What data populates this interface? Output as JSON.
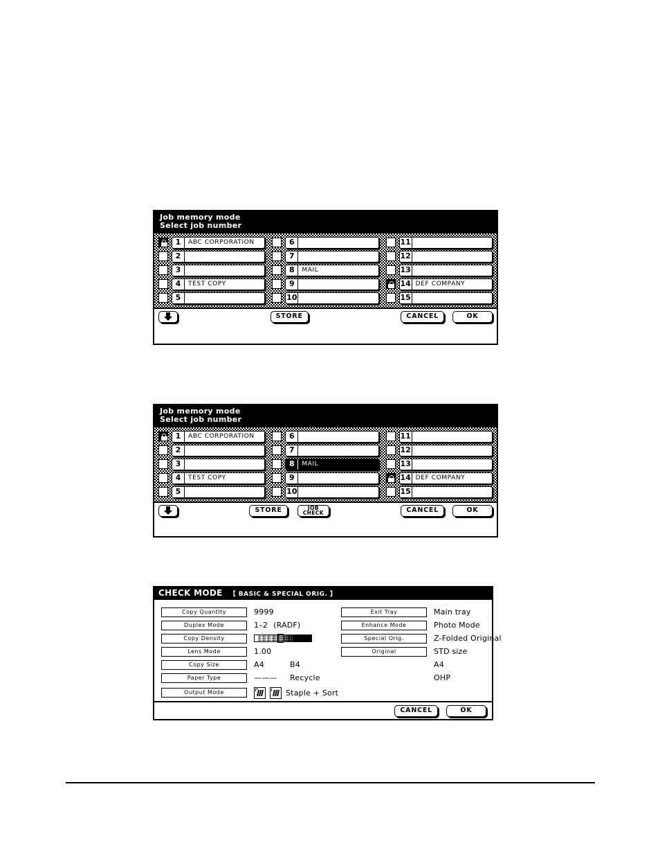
{
  "panels": {
    "job_memory_1": {
      "title_line1": "Job memory mode",
      "title_line2": "Select job number",
      "jobs": [
        {
          "num": "1",
          "name": "ABC CORPORATION",
          "locked": true,
          "selected": false
        },
        {
          "num": "2",
          "name": "",
          "locked": false,
          "selected": false
        },
        {
          "num": "3",
          "name": "",
          "locked": false,
          "selected": false
        },
        {
          "num": "4",
          "name": "TEST COPY",
          "locked": false,
          "selected": false
        },
        {
          "num": "5",
          "name": "",
          "locked": false,
          "selected": false
        },
        {
          "num": "6",
          "name": "",
          "locked": false,
          "selected": false
        },
        {
          "num": "7",
          "name": "",
          "locked": false,
          "selected": false
        },
        {
          "num": "8",
          "name": "MAIL",
          "locked": false,
          "selected": false
        },
        {
          "num": "9",
          "name": "",
          "locked": false,
          "selected": false
        },
        {
          "num": "10",
          "name": "",
          "locked": false,
          "selected": false
        },
        {
          "num": "11",
          "name": "",
          "locked": false,
          "selected": false
        },
        {
          "num": "12",
          "name": "",
          "locked": false,
          "selected": false
        },
        {
          "num": "13",
          "name": "",
          "locked": false,
          "selected": false
        },
        {
          "num": "14",
          "name": "DEF COMPANY",
          "locked": true,
          "selected": false
        },
        {
          "num": "15",
          "name": "",
          "locked": false,
          "selected": false
        }
      ],
      "buttons": {
        "scroll_down": "down-arrow",
        "store": "STORE",
        "cancel": "CANCEL",
        "ok": "OK"
      }
    },
    "job_memory_2": {
      "title_line1": "Job memory mode",
      "title_line2": "Select job number",
      "jobs": [
        {
          "num": "1",
          "name": "ABC CORPORATION",
          "locked": true,
          "selected": false
        },
        {
          "num": "2",
          "name": "",
          "locked": false,
          "selected": false
        },
        {
          "num": "3",
          "name": "",
          "locked": false,
          "selected": false
        },
        {
          "num": "4",
          "name": "TEST COPY",
          "locked": false,
          "selected": false
        },
        {
          "num": "5",
          "name": "",
          "locked": false,
          "selected": false
        },
        {
          "num": "6",
          "name": "",
          "locked": false,
          "selected": false
        },
        {
          "num": "7",
          "name": "",
          "locked": false,
          "selected": false
        },
        {
          "num": "8",
          "name": "MAIL",
          "locked": false,
          "selected": true
        },
        {
          "num": "9",
          "name": "",
          "locked": false,
          "selected": false
        },
        {
          "num": "10",
          "name": "",
          "locked": false,
          "selected": false
        },
        {
          "num": "11",
          "name": "",
          "locked": false,
          "selected": false
        },
        {
          "num": "12",
          "name": "",
          "locked": false,
          "selected": false
        },
        {
          "num": "13",
          "name": "",
          "locked": false,
          "selected": false
        },
        {
          "num": "14",
          "name": "DEF COMPANY",
          "locked": true,
          "selected": false
        },
        {
          "num": "15",
          "name": "",
          "locked": false,
          "selected": false
        }
      ],
      "buttons": {
        "scroll_down": "down-arrow",
        "store": "STORE",
        "job_check_line1": "JOB",
        "job_check_line2": "CHECK",
        "cancel": "CANCEL",
        "ok": "OK"
      }
    },
    "check_mode": {
      "title": "CHECK MODE",
      "subtitle": "【 BASIC & SPECIAL ORIG. 】",
      "left_rows": [
        {
          "label": "Copy Quantity",
          "value": "9999"
        },
        {
          "label": "Duplex Mode",
          "value": "1–2",
          "value2": "(RADF)"
        },
        {
          "label": "Copy Density",
          "value": ""
        },
        {
          "label": "Lens Mode",
          "value": "1.00"
        },
        {
          "label": "Copy Size",
          "value": "A4",
          "value2": "B4"
        },
        {
          "label": "Paper Type",
          "value": "———",
          "value2": "Recycle"
        },
        {
          "label": "Output Mode",
          "value": "Staple + Sort"
        }
      ],
      "right_rows": [
        {
          "label": "Exit Tray",
          "value": "Main tray"
        },
        {
          "label": "Enhance Mode",
          "value": "Photo Mode"
        },
        {
          "label": "Special Orig.",
          "value": "Z-Folded Original"
        },
        {
          "label": "Original",
          "value": "STD size"
        },
        {
          "label": "",
          "value": "A4"
        },
        {
          "label": "",
          "value": "OHP"
        }
      ],
      "density": {
        "steps": 12,
        "selected_index": 5
      },
      "output_icons": [
        "staple-corner-icon",
        "staple-edge-icon"
      ],
      "buttons": {
        "cancel": "CANCEL",
        "ok": "OK"
      }
    }
  }
}
